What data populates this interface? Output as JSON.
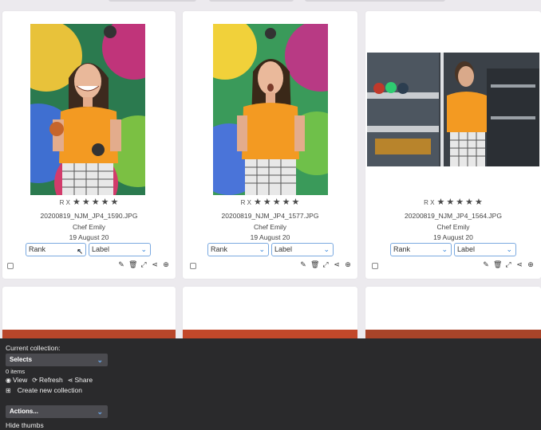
{
  "cards": [
    {
      "rating_flags": "R X",
      "filename": "20200819_NJM_JP4_1590.JPG",
      "caption": "Chef Emily",
      "date": "19 August 20",
      "rank_label": "Rank",
      "label_label": "Label"
    },
    {
      "rating_flags": "R X",
      "filename": "20200819_NJM_JP4_1577.JPG",
      "caption": "Chef Emily",
      "date": "19 August 20",
      "rank_label": "Rank",
      "label_label": "Label"
    },
    {
      "rating_flags": "R X",
      "filename": "20200819_NJM_JP4_1564.JPG",
      "caption": "Chef Emily",
      "date": "19 August 20",
      "rank_label": "Rank",
      "label_label": "Label"
    }
  ],
  "stars": {
    "count": 5,
    "filled": 5,
    "glyph": "★"
  },
  "action_icons": [
    "pencil-icon",
    "trash-icon",
    "expand-icon",
    "share-icon",
    "plus-circle-icon"
  ],
  "collection_panel": {
    "title": "Current collection:",
    "selected": "Selects",
    "item_count": "0 items",
    "view_label": "View",
    "refresh_label": "Refresh",
    "share_label": "Share",
    "create_label": "Create new collection",
    "actions_label": "Actions...",
    "hide_thumbs_label": "Hide thumbs"
  },
  "colors": {
    "accent": "#2f80d8",
    "panel_bg": "#2a2a2c",
    "orange_top": "#f39a22"
  }
}
